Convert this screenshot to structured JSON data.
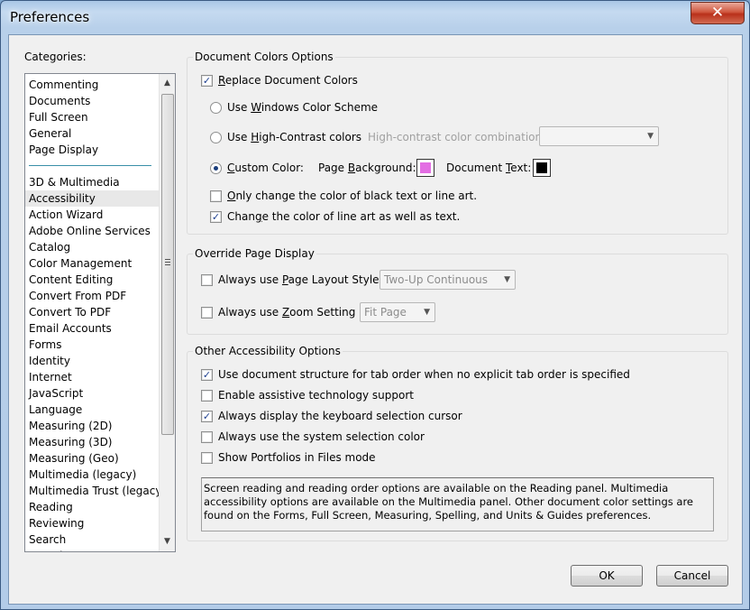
{
  "window": {
    "title": "Preferences",
    "close_symbol": "✕"
  },
  "categories": {
    "label": "Categories:",
    "top_items": [
      "Commenting",
      "Documents",
      "Full Screen",
      "General",
      "Page Display"
    ],
    "items": [
      "3D & Multimedia",
      "Accessibility",
      "Action Wizard",
      "Adobe Online Services",
      "Catalog",
      "Color Management",
      "Content Editing",
      "Convert From PDF",
      "Convert To PDF",
      "Email Accounts",
      "Forms",
      "Identity",
      "Internet",
      "JavaScript",
      "Language",
      "Measuring (2D)",
      "Measuring (3D)",
      "Measuring (Geo)",
      "Multimedia (legacy)",
      "Multimedia Trust (legacy)",
      "Reading",
      "Reviewing",
      "Search",
      "Security"
    ],
    "selected": "Accessibility"
  },
  "doc_colors": {
    "title": "Document Colors Options",
    "replace_label": "Replace Document Colors",
    "replace_checked": true,
    "use_windows_label": "Use Windows Color Scheme",
    "use_high_contrast_label": "Use High-Contrast colors",
    "high_contrast_combo_label": "High-contrast color combination:",
    "high_contrast_combo_value": "",
    "custom_color_label": "Custom Color:",
    "custom_color_selected": true,
    "page_background_label": "Page Background:",
    "page_background_color": "#e36ee3",
    "document_text_label": "Document Text:",
    "document_text_color": "#000000",
    "only_black_label": "Only change the color of black text or line art.",
    "only_black_checked": false,
    "change_line_art_label": "Change the color of line art as well as text.",
    "change_line_art_checked": true
  },
  "override": {
    "title": "Override Page Display",
    "layout_label": "Always use Page Layout Style",
    "layout_checked": false,
    "layout_value": "Two-Up Continuous",
    "zoom_label": "Always use Zoom Setting",
    "zoom_checked": false,
    "zoom_value": "Fit Page"
  },
  "other": {
    "title": "Other Accessibility Options",
    "options": [
      {
        "label": "Use document structure for tab order when no explicit tab order is specified",
        "checked": true
      },
      {
        "label": "Enable assistive technology support",
        "checked": false
      },
      {
        "label": "Always display the keyboard selection cursor",
        "checked": true
      },
      {
        "label": "Always use the system selection color",
        "checked": false
      },
      {
        "label": "Show Portfolios in Files mode",
        "checked": false
      }
    ],
    "note": "Screen reading and reading order options are available on the Reading panel. Multimedia accessibility options are available on the Multimedia panel. Other document color settings are found on the Forms, Full Screen, Measuring, Spelling, and Units & Guides preferences."
  },
  "buttons": {
    "ok": "OK",
    "cancel": "Cancel"
  },
  "icons": {
    "check": "✓",
    "dropdown": "▼",
    "scroll_up": "▲",
    "scroll_down": "▼"
  }
}
